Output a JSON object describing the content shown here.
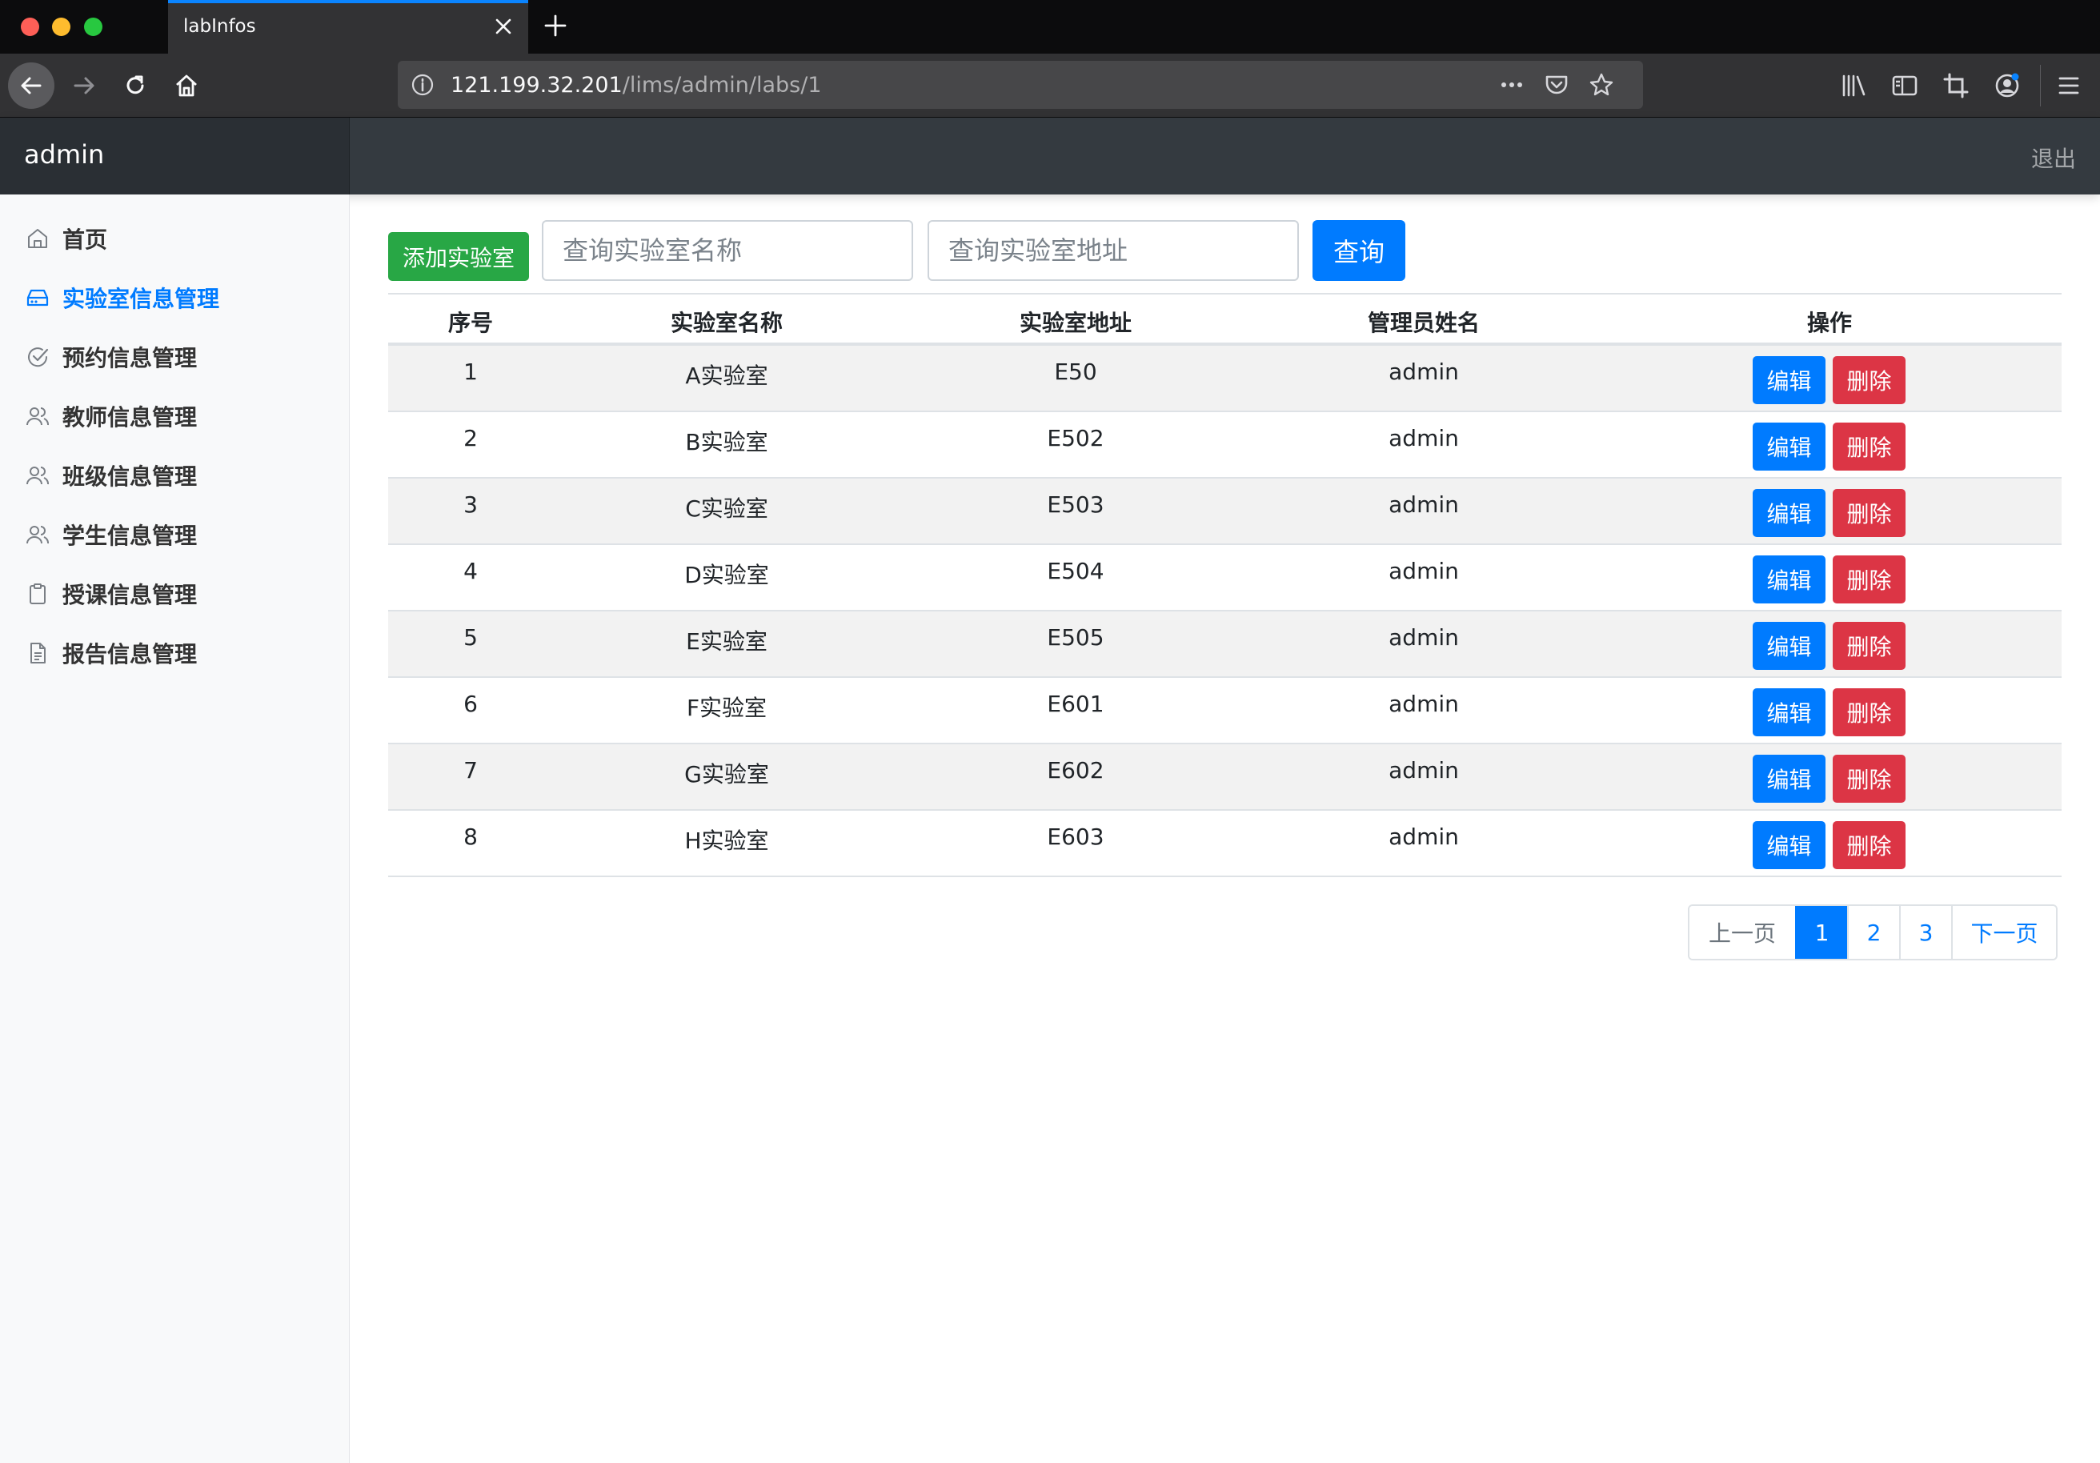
{
  "browser": {
    "tab_title": "labInfos",
    "url_host": "121.199.32.201",
    "url_path": "/lims/admin/labs/1"
  },
  "header": {
    "brand": "admin",
    "logout": "退出"
  },
  "sidebar": {
    "items": [
      {
        "label": "首页",
        "icon": "home-icon"
      },
      {
        "label": "实验室信息管理",
        "icon": "lab-icon",
        "active": true
      },
      {
        "label": "预约信息管理",
        "icon": "check-circle-icon"
      },
      {
        "label": "教师信息管理",
        "icon": "users-icon"
      },
      {
        "label": "班级信息管理",
        "icon": "users-icon"
      },
      {
        "label": "学生信息管理",
        "icon": "users-icon"
      },
      {
        "label": "授课信息管理",
        "icon": "clipboard-icon"
      },
      {
        "label": "报告信息管理",
        "icon": "document-icon"
      }
    ]
  },
  "toolbar": {
    "add_label": "添加实验室",
    "name_placeholder": "查询实验室名称",
    "addr_placeholder": "查询实验室地址",
    "query_label": "查询"
  },
  "table": {
    "headers": [
      "序号",
      "实验室名称",
      "实验室地址",
      "管理员姓名",
      "操作"
    ],
    "rows": [
      [
        "1",
        "A实验室",
        "E50",
        "admin"
      ],
      [
        "2",
        "B实验室",
        "E502",
        "admin"
      ],
      [
        "3",
        "C实验室",
        "E503",
        "admin"
      ],
      [
        "4",
        "D实验室",
        "E504",
        "admin"
      ],
      [
        "5",
        "E实验室",
        "E505",
        "admin"
      ],
      [
        "6",
        "F实验室",
        "E601",
        "admin"
      ],
      [
        "7",
        "G实验室",
        "E602",
        "admin"
      ],
      [
        "8",
        "H实验室",
        "E603",
        "admin"
      ]
    ],
    "edit_label": "编辑",
    "delete_label": "删除"
  },
  "pagination": {
    "prev": "上一页",
    "pages": [
      "1",
      "2",
      "3"
    ],
    "current": "1",
    "next": "下一页"
  },
  "colors": {
    "primary": "#007bff",
    "success": "#28a745",
    "danger": "#dc3545",
    "header_bg": "#343a40"
  }
}
